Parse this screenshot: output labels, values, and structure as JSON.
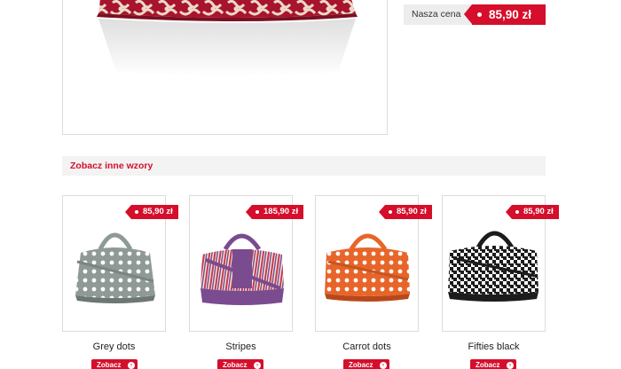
{
  "price_box": {
    "label": "Nasza cena",
    "price": "85,90 zł"
  },
  "section": {
    "title": "Zobacz inne wzory"
  },
  "products": [
    {
      "name": "Grey dots",
      "price": "85,90 zł",
      "button": "Zobacz",
      "body_color": "#8f9a96",
      "pattern": "dots"
    },
    {
      "name": "Stripes",
      "price": "185,90 zł",
      "button": "Zobacz",
      "body_color": "#7a4b8f",
      "pattern": "stripes"
    },
    {
      "name": "Carrot dots",
      "price": "85,90 zł",
      "button": "Zobacz",
      "body_color": "#e8652a",
      "pattern": "dots"
    },
    {
      "name": "Fifties black",
      "price": "85,90 zł",
      "button": "Zobacz",
      "body_color": "#1c1c1c",
      "pattern": "houndstooth"
    }
  ],
  "colors": {
    "accent": "#d50e2b",
    "bar_bg": "#f3f3f3",
    "price_box_bg": "#ededed"
  }
}
